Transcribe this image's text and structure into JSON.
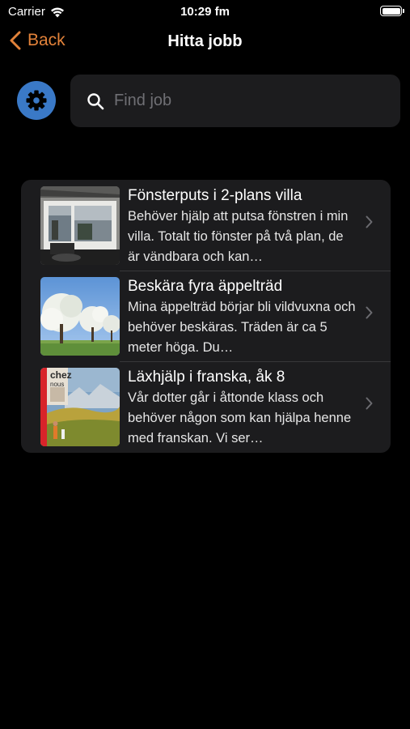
{
  "status_bar": {
    "carrier": "Carrier",
    "time": "10:29 fm"
  },
  "nav": {
    "back_label": "Back",
    "title": "Hitta jobb"
  },
  "search": {
    "placeholder": "Find job",
    "value": ""
  },
  "colors": {
    "accent": "#e2823a",
    "settings_button": "#3a79c7",
    "card_bg": "#1c1c1e"
  },
  "jobs": [
    {
      "title": "Fönsterputs i 2-plans villa",
      "description": "Behöver hjälp att putsa fönstren i min villa. Totalt tio fönster på två plan, de är vändbara och kan…",
      "thumbnail": "window-photo"
    },
    {
      "title": "Beskära fyra äppelträd",
      "description": "Mina äppelträd börjar bli vildvuxna och behöver beskäras. Träden är ca 5 meter höga. Du…",
      "thumbnail": "apple-trees-photo"
    },
    {
      "title": "Läxhjälp i franska, åk 8",
      "description": "Vår dotter går i åttonde klass och behöver någon som kan hjälpa henne med franskan. Vi ser…",
      "thumbnail": "french-book-photo",
      "thumbnail_text": "chez nous"
    }
  ]
}
